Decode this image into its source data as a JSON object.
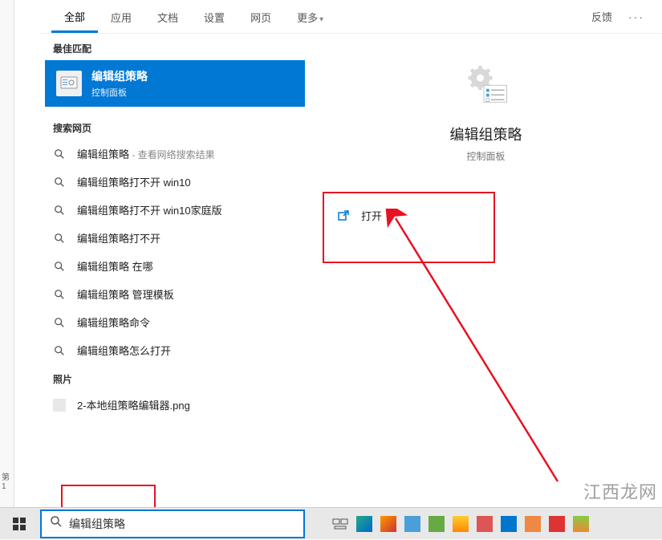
{
  "tabs": {
    "items": [
      "全部",
      "应用",
      "文档",
      "设置",
      "网页",
      "更多"
    ],
    "feedback": "反馈"
  },
  "left": {
    "best_match_header": "最佳匹配",
    "best_match": {
      "title": "编辑组策略",
      "subtitle": "控制面板"
    },
    "web_header": "搜索网页",
    "web_results": [
      {
        "text": "编辑组策略",
        "suffix": " - 查看网络搜索结果"
      },
      {
        "text": "编辑组策略打不开 win10",
        "suffix": ""
      },
      {
        "text": "编辑组策略打不开 win10家庭版",
        "suffix": ""
      },
      {
        "text": "编辑组策略打不开",
        "suffix": ""
      },
      {
        "text": "编辑组策略 在哪",
        "suffix": ""
      },
      {
        "text": "编辑组策略 管理模板",
        "suffix": ""
      },
      {
        "text": "编辑组策略命令",
        "suffix": ""
      },
      {
        "text": "编辑组策略怎么打开",
        "suffix": ""
      }
    ],
    "photos_header": "照片",
    "photo_item": "2-本地组策略编辑器.png"
  },
  "right": {
    "title": "编辑组策略",
    "subtitle": "控制面板",
    "open_label": "打开"
  },
  "taskbar": {
    "search_value": "编辑组策略"
  },
  "watermark": "江西龙网",
  "left_edge": "第 1"
}
